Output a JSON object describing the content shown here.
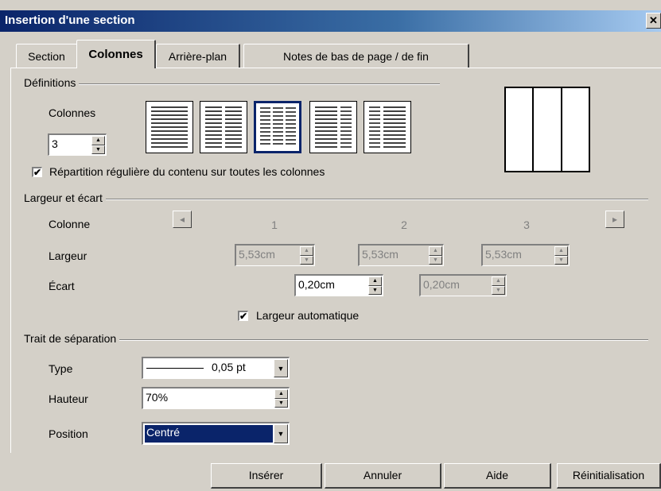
{
  "window": {
    "title": "Insertion d'une section",
    "close_glyph": "✕"
  },
  "tabs": [
    {
      "label": "Section",
      "active": false
    },
    {
      "label": "Colonnes",
      "active": true
    },
    {
      "label": "Arrière-plan",
      "active": false
    },
    {
      "label": "Notes de bas de page / de fin",
      "active": false
    }
  ],
  "definitions": {
    "group_label": "Définitions",
    "columns_label": "Colonnes",
    "columns_value": "3",
    "layouts": [
      {
        "name": "1 colonne",
        "selected": false
      },
      {
        "name": "2 colonnes",
        "selected": false
      },
      {
        "name": "3 colonnes",
        "selected": true
      },
      {
        "name": "2 colonnes (gauche large)",
        "selected": false
      },
      {
        "name": "2 colonnes (droite large)",
        "selected": false
      }
    ],
    "even_distribution_label": "Répartition régulière du contenu sur toutes les colonnes",
    "even_distribution_checked": true,
    "preview_columns": 3
  },
  "width_spacing": {
    "group_label": "Largeur et écart",
    "column_label": "Colonne",
    "column_numbers": [
      "1",
      "2",
      "3"
    ],
    "width_label": "Largeur",
    "widths": [
      "5,53cm",
      "5,53cm",
      "5,53cm"
    ],
    "spacing_label": "Écart",
    "spacings": [
      "0,20cm",
      "0,20cm"
    ],
    "auto_width_label": "Largeur automatique",
    "auto_width_checked": true,
    "prev_glyph": "◂",
    "next_glyph": "▸"
  },
  "separator": {
    "group_label": "Trait de séparation",
    "type_label": "Type",
    "type_value": "0,05 pt",
    "height_label": "Hauteur",
    "height_value": "70%",
    "position_label": "Position",
    "position_value": "Centré"
  },
  "buttons": {
    "insert": "Insérer",
    "cancel": "Annuler",
    "help": "Aide",
    "reset": "Réinitialisation"
  },
  "colors": {
    "title_bar": "#0a246a",
    "selection": "#0a246a",
    "face": "#d4d0c8"
  }
}
